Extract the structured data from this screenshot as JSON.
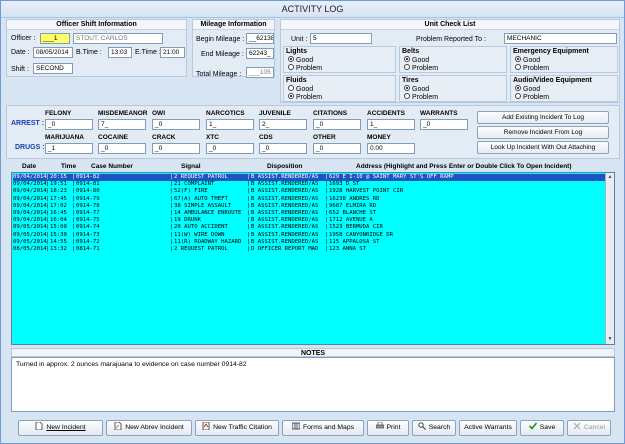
{
  "window": {
    "title": "ACTIVITY LOG"
  },
  "officer_shift": {
    "header": "Officer Shift Information",
    "officer_label": "Officer :",
    "officer_id": "___1",
    "officer_name": "STOUT, CARLOS",
    "date_label": "Date :",
    "date_value": "08/05/2014",
    "btime_label": "B.Time :",
    "btime_value": "13:03",
    "etime_label": "E.Time :",
    "etime_value": "21:00",
    "shift_label": "Shift :",
    "shift_value": "SECOND"
  },
  "mileage": {
    "header": "Mileage Information",
    "begin_label": "Begin Mileage :",
    "begin_value": "__62138",
    "end_label": "End Mileage :",
    "end_value": "62243_",
    "total_label": "Total Mileage :",
    "total_value": "___105"
  },
  "unit_check": {
    "header": "Unit Check List",
    "unit_label": "Unit :",
    "unit_value": "5",
    "problem_label": "Problem Reported To :",
    "problem_value": "MECHANIC",
    "good": "Good",
    "problem": "Problem",
    "groups": [
      {
        "name": "Lights",
        "selected": "good"
      },
      {
        "name": "Belts",
        "selected": "good"
      },
      {
        "name": "Emergency Equipment",
        "selected": "good"
      },
      {
        "name": "Fluids",
        "selected": "problem"
      },
      {
        "name": "Tires",
        "selected": "good"
      },
      {
        "name": "Audio/Video Equipment",
        "selected": "good"
      }
    ]
  },
  "stats": {
    "arrest_label": "ARREST :",
    "drugs_label": "DRUGS :",
    "arrest": [
      {
        "label": "FELONY",
        "value": "_0"
      },
      {
        "label": "MISDEMEANOR",
        "value": "7_"
      },
      {
        "label": "OWI",
        "value": "_0"
      },
      {
        "label": "NARCOTICS",
        "value": "1_"
      },
      {
        "label": "JUVENILE",
        "value": "2_"
      },
      {
        "label": "CITATIONS",
        "value": "_0"
      },
      {
        "label": "ACCIDENTS",
        "value": "1_"
      },
      {
        "label": "WARRANTS",
        "value": "_0"
      }
    ],
    "drugs": [
      {
        "label": "MARIJUANA",
        "value": "_1"
      },
      {
        "label": "COCAINE",
        "value": "_0"
      },
      {
        "label": "CRACK",
        "value": "_0"
      },
      {
        "label": "XTC",
        "value": "_0"
      },
      {
        "label": "CDS",
        "value": "_0"
      },
      {
        "label": "OTHER",
        "value": "_0"
      },
      {
        "label": "MONEY",
        "value": "0.00"
      }
    ]
  },
  "side_buttons": {
    "add": "Add Existing Incident To Log",
    "remove": "Remove Incident From Log",
    "lookup": "Look Up Incident With Out Attaching"
  },
  "table": {
    "headers": {
      "date": "Date",
      "time": "Time",
      "case": "Case Number",
      "signal": "Signal",
      "disposition": "Disposition",
      "address": "Address  (Highlight and Press Enter or Double Click To Open Incident)"
    },
    "rows": [
      {
        "date": "09/04/2014",
        "time": "20:15",
        "case": "0914-82",
        "signal": "2 REQUEST PATROL",
        "disp": "B ASSIST.RENDERED/AS",
        "addr": "629 E I-10 @ SAINT MARY ST'S OFF RAMP"
      },
      {
        "date": "09/04/2014",
        "time": "19:51",
        "case": "0914-81",
        "signal": "21 COMPLAINT",
        "disp": "B ASSIST.RENDERED/AS",
        "addr": "1693 D ST"
      },
      {
        "date": "09/04/2014",
        "time": "18:23",
        "case": "0914-80",
        "signal": "52(F) FIRE",
        "disp": "B ASSIST.RENDERED/AS",
        "addr": "1928 HARVEST POINT CIR"
      },
      {
        "date": "09/04/2014",
        "time": "17:45",
        "case": "0914-79",
        "signal": "67(A) AUTO THEFT",
        "disp": "B ASSIST.RENDERED/AS",
        "addr": "16238 ANDRES RD"
      },
      {
        "date": "09/04/2014",
        "time": "17:02",
        "case": "0914-78",
        "signal": "38 SIMPLE ASSAULT",
        "disp": "B ASSIST.RENDERED/AS",
        "addr": "9687 ELMIRA RD"
      },
      {
        "date": "09/04/2014",
        "time": "16:45",
        "case": "0914-77",
        "signal": "14 AMBULANCE ENROUTE",
        "disp": "B ASSIST.RENDERED/AS",
        "addr": "652 BLANCHE ST"
      },
      {
        "date": "09/04/2014",
        "time": "16:04",
        "case": "0914-75",
        "signal": "19 DRUNK",
        "disp": "B ASSIST.RENDERED/AS",
        "addr": "1712 AVENUE A"
      },
      {
        "date": "09/05/2014",
        "time": "15:00",
        "case": "0914-74",
        "signal": "20 AUTO ACCIDENT",
        "disp": "B ASSIST.RENDERED/AS",
        "addr": "1523  BERMUDA CIR"
      },
      {
        "date": "09/05/2014",
        "time": "15:30",
        "case": "0914-73",
        "signal": "11(W) WIRE DOWN",
        "disp": "B ASSIST.RENDERED/AS",
        "addr": "1958 CANYONRIDGE DR"
      },
      {
        "date": "09/05/2014",
        "time": "14:55",
        "case": "0914-72",
        "signal": "11(R) ROADWAY HAZARD",
        "disp": "B ASSIST.RENDERED/AS",
        "addr": "115 APPALOSA ST"
      },
      {
        "date": "08/05/2014",
        "time": "13:32",
        "case": "0814-71",
        "signal": "2 REQUEST PATROL",
        "disp": "D OFFICER REPORT MAD",
        "addr": "123  ANNA ST"
      }
    ]
  },
  "notes": {
    "header": "NOTES",
    "text": "Turned in approx. 2 ounces marajuana to evidence on case number 0914-82"
  },
  "bottom_buttons": {
    "new_incident": "New Incident",
    "new_abrev": "New Abrev Incident",
    "new_traffic": "New Traffic Citation",
    "forms": "Forms and Maps",
    "print": "Print",
    "search": "Search",
    "warrants": "Active Warrants",
    "save": "Save",
    "cancel": "Cancel"
  },
  "colors": {
    "list_bg": "#00ffff",
    "selected_row": "#1c54c4",
    "officer_highlight": "#ffff66"
  }
}
